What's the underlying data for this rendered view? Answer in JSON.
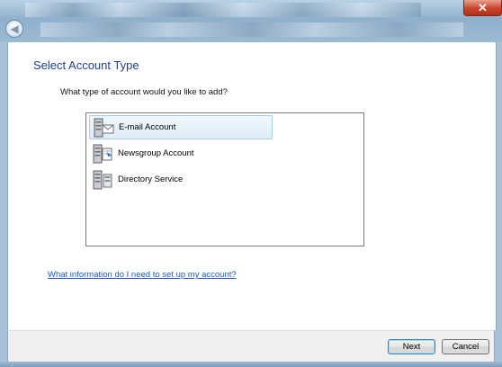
{
  "window": {
    "close_glyph": "✕",
    "back_glyph": "◀"
  },
  "wizard": {
    "heading": "Select Account Type",
    "question": "What type of account would you like to add?",
    "account_types": [
      {
        "label": "E-mail Account",
        "icon": "email-account-icon",
        "selected": true
      },
      {
        "label": "Newsgroup Account",
        "icon": "newsgroup-account-icon",
        "selected": false
      },
      {
        "label": "Directory Service",
        "icon": "directory-service-icon",
        "selected": false
      }
    ],
    "help_link": "What information do I need to set up my account?"
  },
  "footer": {
    "next_label": "Next",
    "cancel_label": "Cancel"
  },
  "colors": {
    "heading": "#1e3f8c",
    "link": "#2257b8",
    "selection": "#deedf8"
  }
}
